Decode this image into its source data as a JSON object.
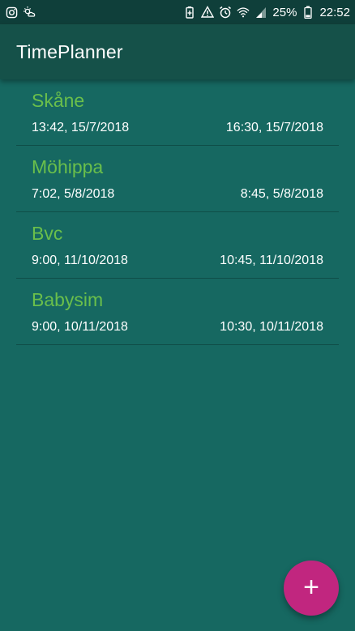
{
  "status_bar": {
    "left_icons": [
      "instagram-icon",
      "weather-icon"
    ],
    "right_icons": [
      "battery-saver-icon",
      "sync-warning-icon",
      "alarm-icon",
      "wifi-icon",
      "signal-icon",
      "battery-icon"
    ],
    "battery_percent": "25%",
    "time": "22:52"
  },
  "app_bar": {
    "title": "TimePlanner"
  },
  "events": [
    {
      "name": "Skåne",
      "start": "13:42, 15/7/2018",
      "end": "16:30, 15/7/2018"
    },
    {
      "name": "Möhippa",
      "start": "7:02, 5/8/2018",
      "end": "8:45, 5/8/2018"
    },
    {
      "name": "Bvc",
      "start": "9:00, 11/10/2018",
      "end": "10:45, 11/10/2018"
    },
    {
      "name": "Babysim",
      "start": "9:00, 10/11/2018",
      "end": "10:30, 10/11/2018"
    }
  ],
  "fab": {
    "icon": "plus-icon",
    "label": "+"
  },
  "colors": {
    "background": "#166861",
    "app_bar": "#155149",
    "event_name": "#6abf4b",
    "fab": "#c1267f"
  }
}
